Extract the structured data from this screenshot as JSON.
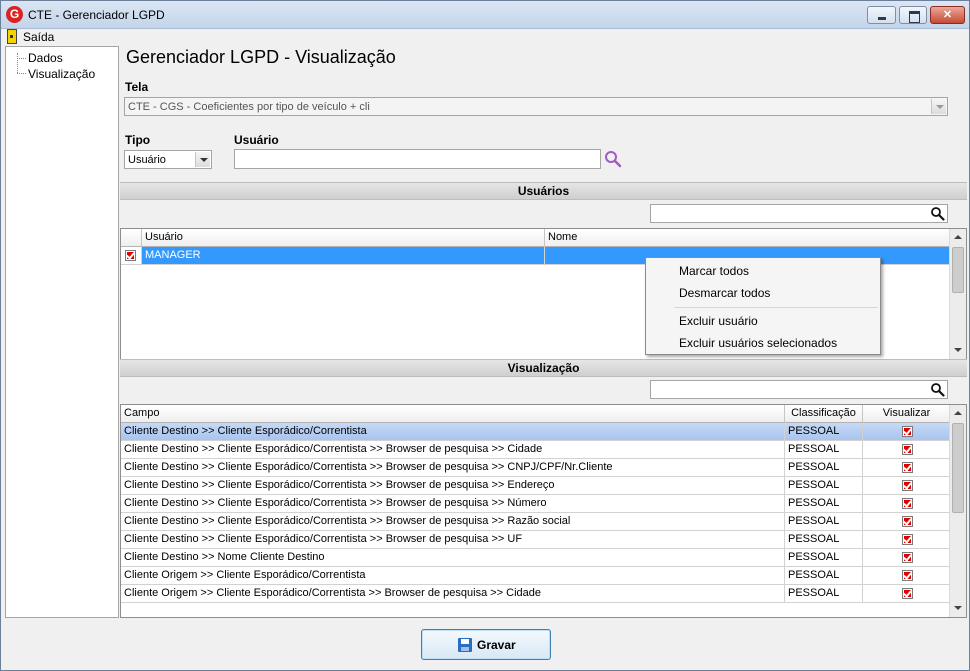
{
  "window": {
    "title": "CTE - Gerenciador LGPD",
    "app_icon_letter": "G",
    "minimize_label": "",
    "maximize_label": "",
    "close_label": ""
  },
  "menu": {
    "exit_label": "Saída"
  },
  "tree": {
    "items": [
      "Dados",
      "Visualização"
    ]
  },
  "page": {
    "title": "Gerenciador LGPD - Visualização",
    "tela_label": "Tela",
    "tela_value": "CTE - CGS - Coeficientes por tipo de veículo + cli",
    "tipo_label": "Tipo",
    "tipo_value": "Usuário",
    "usuario_label": "Usuário",
    "usuario_value": ""
  },
  "users_section": {
    "title": "Usuários",
    "filter_value": "",
    "columns": [
      "Usuário",
      "Nome"
    ],
    "rows": [
      {
        "checked": true,
        "usuario": "MANAGER",
        "nome": ""
      }
    ]
  },
  "context_menu": {
    "items": [
      "Marcar todos",
      "Desmarcar todos",
      "Excluir usuário",
      "Excluir usuários selecionados"
    ]
  },
  "view_section": {
    "title": "Visualização",
    "filter_value": "",
    "columns": [
      "Campo",
      "Classificação",
      "Visualizar"
    ],
    "rows": [
      {
        "campo": "Cliente Destino >> Cliente Esporádico/Correntista",
        "classificacao": "PESSOAL",
        "visualizar": true
      },
      {
        "campo": "Cliente Destino >> Cliente Esporádico/Correntista >> Browser de pesquisa >> Cidade",
        "classificacao": "PESSOAL",
        "visualizar": true
      },
      {
        "campo": "Cliente Destino >> Cliente Esporádico/Correntista >> Browser de pesquisa >> CNPJ/CPF/Nr.Cliente",
        "classificacao": "PESSOAL",
        "visualizar": true
      },
      {
        "campo": "Cliente Destino >> Cliente Esporádico/Correntista >> Browser de pesquisa >> Endereço",
        "classificacao": "PESSOAL",
        "visualizar": true
      },
      {
        "campo": "Cliente Destino >> Cliente Esporádico/Correntista >> Browser de pesquisa >> Número",
        "classificacao": "PESSOAL",
        "visualizar": true
      },
      {
        "campo": "Cliente Destino >> Cliente Esporádico/Correntista >> Browser de pesquisa >> Razão social",
        "classificacao": "PESSOAL",
        "visualizar": true
      },
      {
        "campo": "Cliente Destino >> Cliente Esporádico/Correntista >> Browser de pesquisa >> UF",
        "classificacao": "PESSOAL",
        "visualizar": true
      },
      {
        "campo": "Cliente Destino >> Nome Cliente Destino",
        "classificacao": "PESSOAL",
        "visualizar": true
      },
      {
        "campo": "Cliente Origem >> Cliente Esporádico/Correntista",
        "classificacao": "PESSOAL",
        "visualizar": true
      },
      {
        "campo": "Cliente Origem >> Cliente Esporádico/Correntista >> Browser de pesquisa >> Cidade",
        "classificacao": "PESSOAL",
        "visualizar": true
      }
    ]
  },
  "footer": {
    "save_label": "Gravar"
  },
  "colors": {
    "selection_blue": "#3399ff",
    "check_red": "#e00000",
    "search_purple": "#9b59b6"
  },
  "icons": [
    "app-logo-icon",
    "minimize-icon",
    "maximize-icon",
    "close-icon",
    "exit-door-icon",
    "search-icon",
    "dropdown-arrow-icon",
    "checkbox-checked-icon",
    "save-disk-icon"
  ]
}
